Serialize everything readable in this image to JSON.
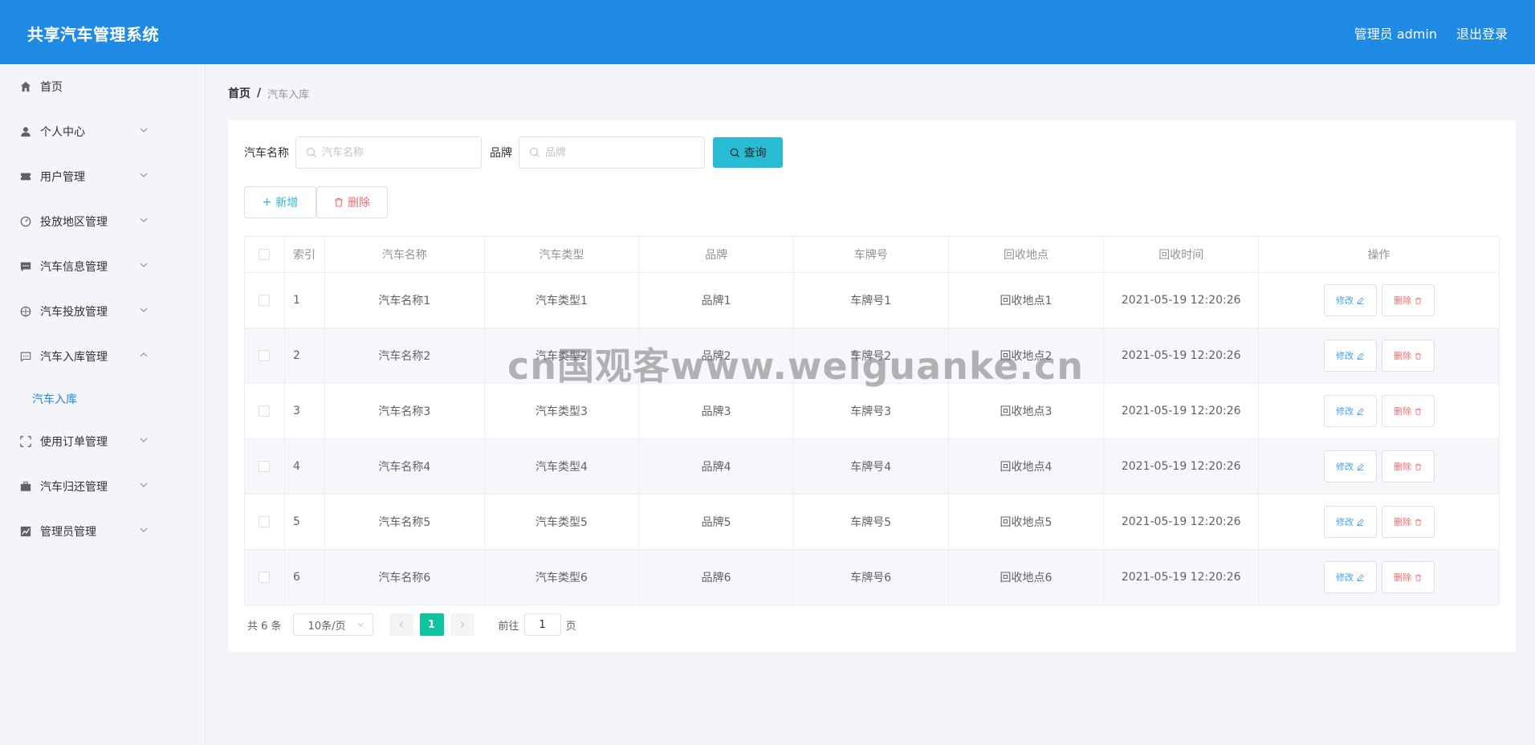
{
  "header": {
    "title": "共享汽车管理系统",
    "user_label": "管理员 admin",
    "logout_label": "退出登录"
  },
  "sidebar": {
    "items": [
      {
        "label": "首页",
        "icon": "home-icon"
      },
      {
        "label": "个人中心",
        "icon": "user-icon"
      },
      {
        "label": "用户管理",
        "icon": "ticket-icon"
      },
      {
        "label": "投放地区管理",
        "icon": "gauge-icon"
      },
      {
        "label": "汽车信息管理",
        "icon": "chat-icon"
      },
      {
        "label": "汽车投放管理",
        "icon": "compass-icon"
      },
      {
        "label": "汽车入库管理",
        "icon": "message-icon"
      },
      {
        "label": "使用订单管理",
        "icon": "fullscreen-icon"
      },
      {
        "label": "汽车归还管理",
        "icon": "briefcase-icon"
      },
      {
        "label": "管理员管理",
        "icon": "chart-icon"
      }
    ],
    "active_sub": "汽车入库"
  },
  "breadcrumb": {
    "home": "首页",
    "separator": "/",
    "current": "汽车入库"
  },
  "search": {
    "name_label": "汽车名称",
    "name_placeholder": "汽车名称",
    "brand_label": "品牌",
    "brand_placeholder": "品牌",
    "query_label": "查询"
  },
  "actions": {
    "add_label": "新增",
    "delete_label": "删除"
  },
  "table": {
    "headers": [
      "索引",
      "汽车名称",
      "汽车类型",
      "品牌",
      "车牌号",
      "回收地点",
      "回收时间",
      "操作"
    ],
    "rows": [
      [
        "1",
        "汽车名称1",
        "汽车类型1",
        "品牌1",
        "车牌号1",
        "回收地点1",
        "2021-05-19 12:20:26"
      ],
      [
        "2",
        "汽车名称2",
        "汽车类型2",
        "品牌2",
        "车牌号2",
        "回收地点2",
        "2021-05-19 12:20:26"
      ],
      [
        "3",
        "汽车名称3",
        "汽车类型3",
        "品牌3",
        "车牌号3",
        "回收地点3",
        "2021-05-19 12:20:26"
      ],
      [
        "4",
        "汽车名称4",
        "汽车类型4",
        "品牌4",
        "车牌号4",
        "回收地点4",
        "2021-05-19 12:20:26"
      ],
      [
        "5",
        "汽车名称5",
        "汽车类型5",
        "品牌5",
        "车牌号5",
        "回收地点5",
        "2021-05-19 12:20:26"
      ],
      [
        "6",
        "汽车名称6",
        "汽车类型6",
        "品牌6",
        "车牌号6",
        "回收地点6",
        "2021-05-19 12:20:26"
      ]
    ],
    "edit_label": "修改",
    "delete_label": "删除"
  },
  "pagination": {
    "total": "共 6 条",
    "page_size": "10条/页",
    "current_page": "1",
    "goto_label": "前往",
    "goto_value": "1",
    "page_suffix": "页"
  },
  "watermark": "cn国观客www.weiguanke.cn",
  "colors": {
    "header_bg": "#1e8ae3",
    "query_button": "#27bcd4",
    "active_page": "#10c39f",
    "danger": "#f56c6c"
  }
}
